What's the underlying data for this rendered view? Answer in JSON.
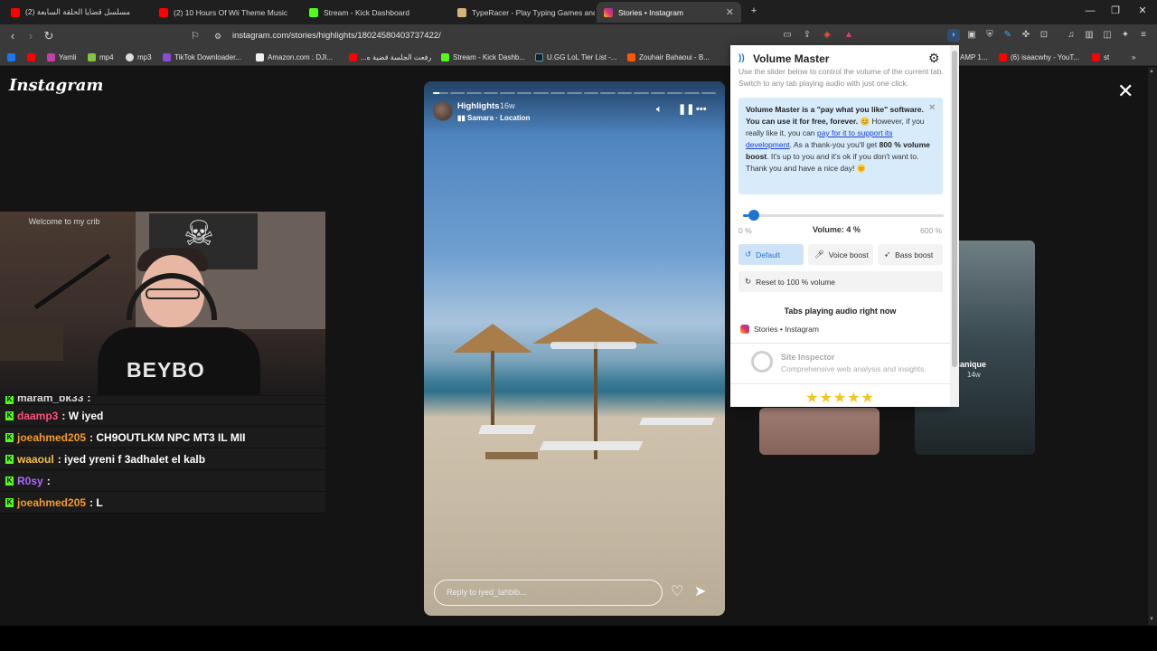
{
  "browser": {
    "tabs": [
      {
        "title": "مسلسل قضايا الحلقة السابعة (2)",
        "active": false
      },
      {
        "title": "(2) 10 Hours Of Wii Theme Music",
        "active": false
      },
      {
        "title": "Stream - Kick Dashboard",
        "active": false
      },
      {
        "title": "TypeRacer - Play Typing Games and",
        "active": false
      },
      {
        "title": "Stories • Instagram",
        "active": true
      }
    ],
    "new_tab": "+",
    "url": "instagram.com/stories/highlights/18024580403737422/",
    "bookmarks": [
      "Yamli",
      "mp4",
      "mp3",
      "TikTok Downloader...",
      "Amazon.com : DJI...",
      "رفعت الجلسة قضية ه...",
      "Stream - Kick Dashb...",
      "U.GG LoL Tier List -...",
      "Zouhair Bahaoui - B...",
      "AMP 1...",
      "(6) isaacwhy - YouT...",
      "st"
    ]
  },
  "instagram": {
    "logo": "Instagram",
    "story": {
      "title": "Highlights",
      "age": "16w",
      "music": "Samara · Location",
      "reply_placeholder": "Reply to iyed_lahbib...",
      "segments_total": 17,
      "current_segment_progress": 0.4
    },
    "side_card": {
      "label": "écanique",
      "age": "14w"
    }
  },
  "stream": {
    "welcome": "Welcome to my crib",
    "shirt": "BEYBO",
    "chat": [
      {
        "user": "maram_bk33",
        "msg": ":",
        "color": "#d9d9d9",
        "partial": true
      },
      {
        "user": "daamp3",
        "msg": ": W iyed",
        "color": "#ff4f7b"
      },
      {
        "user": "joeahmed205",
        "msg": ": CH9OUTLKM NPC MT3 IL MII",
        "color": "#f59a2b"
      },
      {
        "user": "waaoul",
        "msg": ": iyed yreni f 3adhalet el kalb",
        "color": "#f3c14b"
      },
      {
        "user": "R0sy",
        "msg": ":",
        "color": "#b066ff"
      },
      {
        "user": "joeahmed205",
        "msg": ": L",
        "color": "#f59a2b"
      }
    ]
  },
  "volume_master": {
    "title": "Volume Master",
    "subtitle": "Use the slider below to control the volume of the current tab. Switch to any tab playing audio with just one click.",
    "note": {
      "line1": "Volume Master is a \"pay what you like\" software. You can use it for free, forever.",
      "line2a": "However, if you really like it, you can",
      "link": "pay for it to support its development",
      "line2b": ". As a thank-you you'll get",
      "boost": "800 % volume boost",
      "line3": ". It's up to you and it's ok if you don't want to. Thank you and have a nice day!"
    },
    "volume_percent": 4,
    "volume_label": "Volume: 4 %",
    "min_label": "0 %",
    "max_label": "600 %",
    "max_value": 600,
    "buttons": {
      "default": "Default",
      "voice": "Voice boost",
      "bass": "Bass boost",
      "reset": "Reset to 100 % volume"
    },
    "tabs_title": "Tabs playing audio right now",
    "tab_item": "Stories • Instagram",
    "promo_title": "Site Inspector",
    "promo_desc": "Comprehensive web analysis and insights.",
    "stars": "★★★★★",
    "accent": "#1f73d1"
  }
}
